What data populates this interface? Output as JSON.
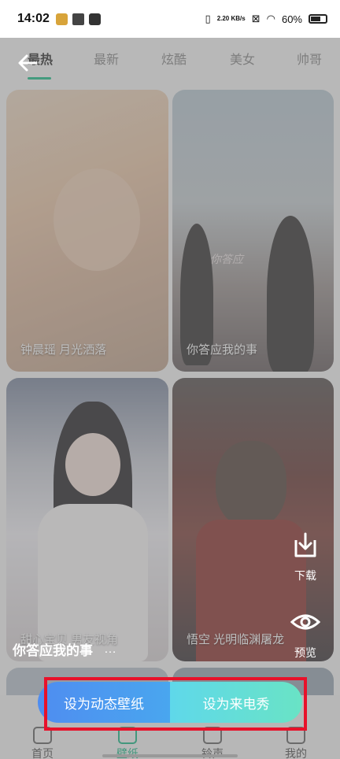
{
  "status_bar": {
    "time": "14:02",
    "net_speed": "2.20 KB/s",
    "battery": "60%"
  },
  "tabs": [
    {
      "label": "最热",
      "active": true
    },
    {
      "label": "最新",
      "active": false
    },
    {
      "label": "炫酷",
      "active": false
    },
    {
      "label": "美女",
      "active": false
    },
    {
      "label": "帅哥",
      "active": false
    }
  ],
  "cards": [
    {
      "caption": "钟晨瑶 月光洒落"
    },
    {
      "caption": "你答应我的事",
      "overlay_text": "你答应"
    },
    {
      "caption": "甜心宝贝 男友视角"
    },
    {
      "caption": "悟空 光明临渊屠龙"
    }
  ],
  "preview": {
    "title": "你答应我的事",
    "more": "…"
  },
  "side_actions": {
    "download": "下载",
    "preview": "预览"
  },
  "actions": {
    "set_live_wallpaper": "设为动态壁纸",
    "set_caller_show": "设为来电秀"
  },
  "bottom_nav": [
    {
      "label": "首页",
      "active": false
    },
    {
      "label": "壁纸",
      "active": true
    },
    {
      "label": "铃声",
      "active": false
    },
    {
      "label": "我的",
      "active": false
    }
  ],
  "colors": {
    "accent": "#1fb889",
    "highlight_box": "#e8112a"
  }
}
